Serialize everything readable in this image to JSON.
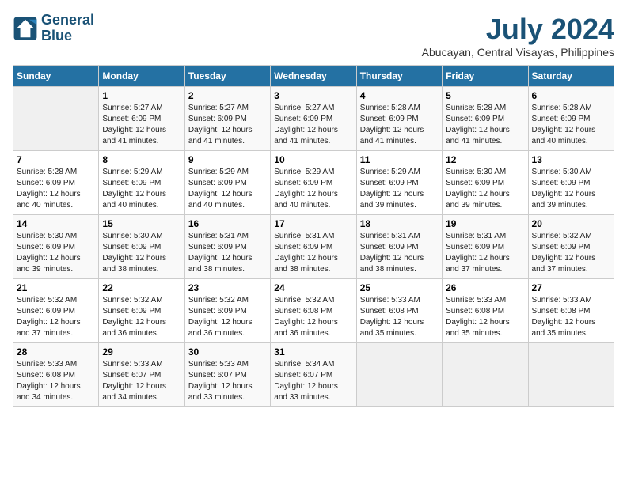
{
  "logo": {
    "line1": "General",
    "line2": "Blue"
  },
  "title": "July 2024",
  "subtitle": "Abucayan, Central Visayas, Philippines",
  "days_header": [
    "Sunday",
    "Monday",
    "Tuesday",
    "Wednesday",
    "Thursday",
    "Friday",
    "Saturday"
  ],
  "weeks": [
    [
      {
        "num": "",
        "info": ""
      },
      {
        "num": "1",
        "info": "Sunrise: 5:27 AM\nSunset: 6:09 PM\nDaylight: 12 hours\nand 41 minutes."
      },
      {
        "num": "2",
        "info": "Sunrise: 5:27 AM\nSunset: 6:09 PM\nDaylight: 12 hours\nand 41 minutes."
      },
      {
        "num": "3",
        "info": "Sunrise: 5:27 AM\nSunset: 6:09 PM\nDaylight: 12 hours\nand 41 minutes."
      },
      {
        "num": "4",
        "info": "Sunrise: 5:28 AM\nSunset: 6:09 PM\nDaylight: 12 hours\nand 41 minutes."
      },
      {
        "num": "5",
        "info": "Sunrise: 5:28 AM\nSunset: 6:09 PM\nDaylight: 12 hours\nand 41 minutes."
      },
      {
        "num": "6",
        "info": "Sunrise: 5:28 AM\nSunset: 6:09 PM\nDaylight: 12 hours\nand 40 minutes."
      }
    ],
    [
      {
        "num": "7",
        "info": "Sunrise: 5:28 AM\nSunset: 6:09 PM\nDaylight: 12 hours\nand 40 minutes."
      },
      {
        "num": "8",
        "info": "Sunrise: 5:29 AM\nSunset: 6:09 PM\nDaylight: 12 hours\nand 40 minutes."
      },
      {
        "num": "9",
        "info": "Sunrise: 5:29 AM\nSunset: 6:09 PM\nDaylight: 12 hours\nand 40 minutes."
      },
      {
        "num": "10",
        "info": "Sunrise: 5:29 AM\nSunset: 6:09 PM\nDaylight: 12 hours\nand 40 minutes."
      },
      {
        "num": "11",
        "info": "Sunrise: 5:29 AM\nSunset: 6:09 PM\nDaylight: 12 hours\nand 39 minutes."
      },
      {
        "num": "12",
        "info": "Sunrise: 5:30 AM\nSunset: 6:09 PM\nDaylight: 12 hours\nand 39 minutes."
      },
      {
        "num": "13",
        "info": "Sunrise: 5:30 AM\nSunset: 6:09 PM\nDaylight: 12 hours\nand 39 minutes."
      }
    ],
    [
      {
        "num": "14",
        "info": "Sunrise: 5:30 AM\nSunset: 6:09 PM\nDaylight: 12 hours\nand 39 minutes."
      },
      {
        "num": "15",
        "info": "Sunrise: 5:30 AM\nSunset: 6:09 PM\nDaylight: 12 hours\nand 38 minutes."
      },
      {
        "num": "16",
        "info": "Sunrise: 5:31 AM\nSunset: 6:09 PM\nDaylight: 12 hours\nand 38 minutes."
      },
      {
        "num": "17",
        "info": "Sunrise: 5:31 AM\nSunset: 6:09 PM\nDaylight: 12 hours\nand 38 minutes."
      },
      {
        "num": "18",
        "info": "Sunrise: 5:31 AM\nSunset: 6:09 PM\nDaylight: 12 hours\nand 38 minutes."
      },
      {
        "num": "19",
        "info": "Sunrise: 5:31 AM\nSunset: 6:09 PM\nDaylight: 12 hours\nand 37 minutes."
      },
      {
        "num": "20",
        "info": "Sunrise: 5:32 AM\nSunset: 6:09 PM\nDaylight: 12 hours\nand 37 minutes."
      }
    ],
    [
      {
        "num": "21",
        "info": "Sunrise: 5:32 AM\nSunset: 6:09 PM\nDaylight: 12 hours\nand 37 minutes."
      },
      {
        "num": "22",
        "info": "Sunrise: 5:32 AM\nSunset: 6:09 PM\nDaylight: 12 hours\nand 36 minutes."
      },
      {
        "num": "23",
        "info": "Sunrise: 5:32 AM\nSunset: 6:09 PM\nDaylight: 12 hours\nand 36 minutes."
      },
      {
        "num": "24",
        "info": "Sunrise: 5:32 AM\nSunset: 6:08 PM\nDaylight: 12 hours\nand 36 minutes."
      },
      {
        "num": "25",
        "info": "Sunrise: 5:33 AM\nSunset: 6:08 PM\nDaylight: 12 hours\nand 35 minutes."
      },
      {
        "num": "26",
        "info": "Sunrise: 5:33 AM\nSunset: 6:08 PM\nDaylight: 12 hours\nand 35 minutes."
      },
      {
        "num": "27",
        "info": "Sunrise: 5:33 AM\nSunset: 6:08 PM\nDaylight: 12 hours\nand 35 minutes."
      }
    ],
    [
      {
        "num": "28",
        "info": "Sunrise: 5:33 AM\nSunset: 6:08 PM\nDaylight: 12 hours\nand 34 minutes."
      },
      {
        "num": "29",
        "info": "Sunrise: 5:33 AM\nSunset: 6:07 PM\nDaylight: 12 hours\nand 34 minutes."
      },
      {
        "num": "30",
        "info": "Sunrise: 5:33 AM\nSunset: 6:07 PM\nDaylight: 12 hours\nand 33 minutes."
      },
      {
        "num": "31",
        "info": "Sunrise: 5:34 AM\nSunset: 6:07 PM\nDaylight: 12 hours\nand 33 minutes."
      },
      {
        "num": "",
        "info": ""
      },
      {
        "num": "",
        "info": ""
      },
      {
        "num": "",
        "info": ""
      }
    ]
  ]
}
